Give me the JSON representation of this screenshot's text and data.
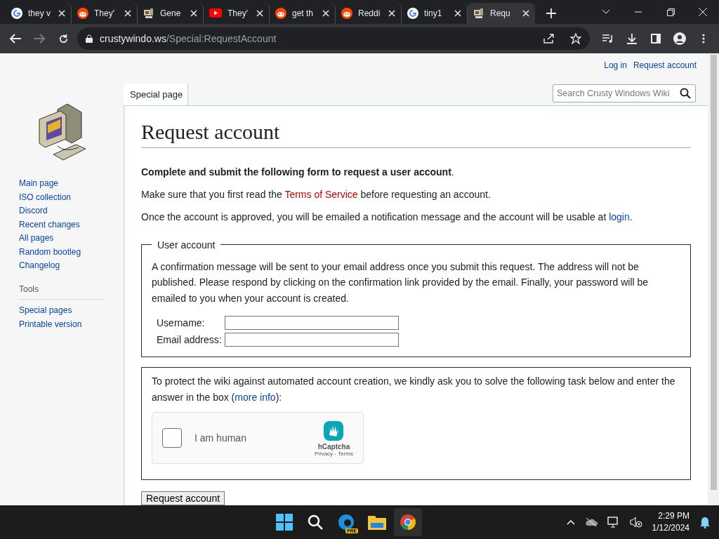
{
  "browser": {
    "tabs": [
      {
        "kind": "google",
        "title": "they v",
        "selected": false
      },
      {
        "kind": "reddit",
        "title": "They'",
        "selected": false
      },
      {
        "kind": "wiki",
        "title": "Gene",
        "selected": false
      },
      {
        "kind": "youtube",
        "title": "They'",
        "selected": false
      },
      {
        "kind": "reddit",
        "title": "get th",
        "selected": false
      },
      {
        "kind": "reddit",
        "title": "Reddi",
        "selected": false
      },
      {
        "kind": "google",
        "title": "tiny1",
        "selected": false
      },
      {
        "kind": "wiki",
        "title": "Requ",
        "selected": true
      }
    ],
    "url_host": "crustywindo.ws",
    "url_path": "/Special:RequestAccount"
  },
  "personal": [
    "Log in",
    "Request account"
  ],
  "sidebar": {
    "nav": [
      "Main page",
      "ISO collection",
      "Discord",
      "Recent changes",
      "All pages",
      "Random bootleg",
      "Changelog"
    ],
    "tools_heading": "Tools",
    "tools": [
      "Special pages",
      "Printable version"
    ]
  },
  "page_tab": "Special page",
  "search": {
    "placeholder": "Search Crusty Windows Wiki"
  },
  "title": "Request account",
  "intro": "**Complete and submit the following form to request a user account**.",
  "tos": {
    "before": "Make sure that you first read the",
    "link": "Terms of Service",
    "after": "before requesting an account."
  },
  "approved": {
    "before": "Once the account is approved, you will be emailed a notification message and the account will be usable at",
    "link": "login",
    "after": "."
  },
  "user_account": {
    "legend": "User account",
    "text": "A confirmation message will be sent to your email address once you submit this request. The address will not be published. Please respond by clicking on the confirmation link provided by the email. Finally, your password will be emailed to you when your account is created.",
    "fields": [
      "Username:",
      "Email address:"
    ]
  },
  "captcha": {
    "before": "To protect the wiki against automated account creation, we kindly ask you to solve the following task below and enter the answer in the box (",
    "link": "more info",
    "after": "):",
    "label": "I am human",
    "checked": false,
    "brand": "hCaptcha",
    "privacy": "Privacy",
    "sep": " - ",
    "terms": "Terms"
  },
  "submit": "Request account",
  "taskbar": {
    "time": "2:29 PM",
    "date": "1/12/2024",
    "badge": "PRE"
  }
}
